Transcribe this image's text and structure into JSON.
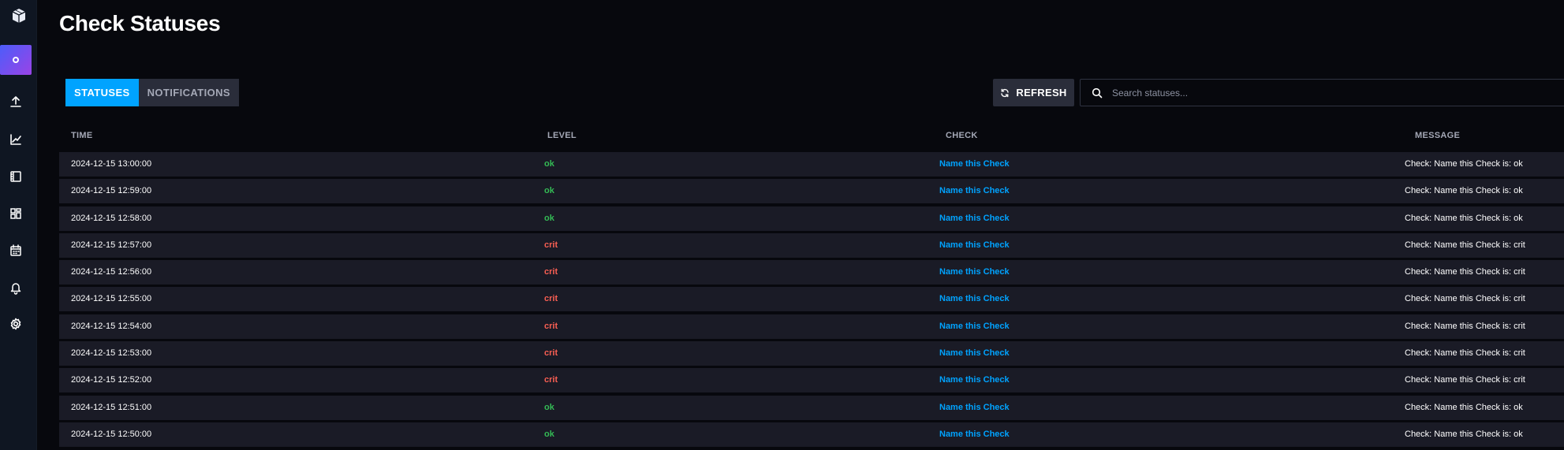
{
  "page": {
    "title": "Check Statuses"
  },
  "sidebar": {
    "items": [
      {
        "icon": "data-explorer-icon",
        "active": true
      },
      {
        "icon": "upload-icon",
        "active": false
      },
      {
        "icon": "graph-icon",
        "active": false
      },
      {
        "icon": "notebook-icon",
        "active": false
      },
      {
        "icon": "dashboard-icon",
        "active": false
      },
      {
        "icon": "calendar-icon",
        "active": false
      },
      {
        "icon": "bell-icon",
        "active": false
      },
      {
        "icon": "gear-icon",
        "active": false
      }
    ]
  },
  "tabs": [
    {
      "label": "STATUSES",
      "active": true
    },
    {
      "label": "NOTIFICATIONS",
      "active": false
    }
  ],
  "toolbar": {
    "refresh_label": "REFRESH",
    "search_placeholder": "Search statuses..."
  },
  "table": {
    "headers": {
      "time": "TIME",
      "level": "LEVEL",
      "check": "CHECK",
      "message": "MESSAGE"
    },
    "rows": [
      {
        "time": "2024-12-15 13:00:00",
        "level": "ok",
        "check": "Name this Check",
        "message": "Check: Name this Check is: ok"
      },
      {
        "time": "2024-12-15 12:59:00",
        "level": "ok",
        "check": "Name this Check",
        "message": "Check: Name this Check is: ok"
      },
      {
        "time": "2024-12-15 12:58:00",
        "level": "ok",
        "check": "Name this Check",
        "message": "Check: Name this Check is: ok"
      },
      {
        "time": "2024-12-15 12:57:00",
        "level": "crit",
        "check": "Name this Check",
        "message": "Check: Name this Check is: crit"
      },
      {
        "time": "2024-12-15 12:56:00",
        "level": "crit",
        "check": "Name this Check",
        "message": "Check: Name this Check is: crit"
      },
      {
        "time": "2024-12-15 12:55:00",
        "level": "crit",
        "check": "Name this Check",
        "message": "Check: Name this Check is: crit"
      },
      {
        "time": "2024-12-15 12:54:00",
        "level": "crit",
        "check": "Name this Check",
        "message": "Check: Name this Check is: crit"
      },
      {
        "time": "2024-12-15 12:53:00",
        "level": "crit",
        "check": "Name this Check",
        "message": "Check: Name this Check is: crit"
      },
      {
        "time": "2024-12-15 12:52:00",
        "level": "crit",
        "check": "Name this Check",
        "message": "Check: Name this Check is: crit"
      },
      {
        "time": "2024-12-15 12:51:00",
        "level": "ok",
        "check": "Name this Check",
        "message": "Check: Name this Check is: ok"
      },
      {
        "time": "2024-12-15 12:50:00",
        "level": "ok",
        "check": "Name this Check",
        "message": "Check: Name this Check is: ok"
      }
    ]
  },
  "colors": {
    "accent": "#00a3ff",
    "ok": "#34bb55",
    "crit": "#f95f53",
    "background": "#07080d",
    "row": "#1a1b26"
  }
}
